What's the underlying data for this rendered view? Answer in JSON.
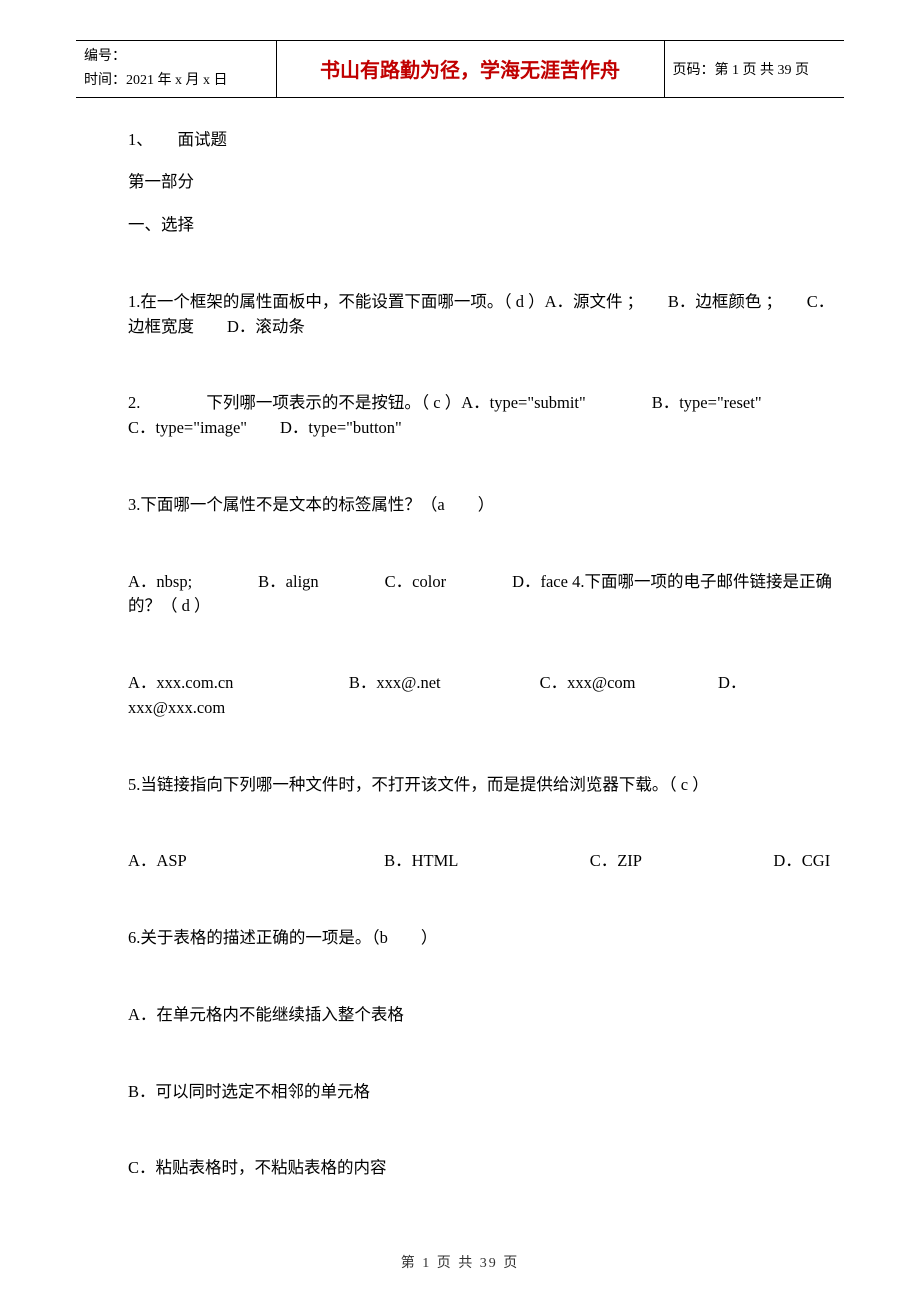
{
  "header": {
    "id_label": "编号：",
    "date_label": "时间：2021 年 x 月 x 日",
    "motto": "书山有路勤为径，学海无涯苦作舟",
    "page_label": "页码：第 1 页 共 39 页"
  },
  "content": {
    "title": "1、　　面试题",
    "part": "第一部分",
    "section": "一、选择",
    "q1": "1.在一个框架的属性面板中，不能设置下面哪一项。（  d  ）A．源文件 ；　　B．边框颜色 ；　　C．边框宽度　　D．滚动条",
    "q2": "2.　　　　下列哪一项表示的不是按钮。（  c  ）A．type=\"submit\"　　　　B．type=\"reset\"　　　　　　C．type=\"image\"　　D．type=\"button\"",
    "q3": "3.下面哪一个属性不是文本的标签属性？（a　　）",
    "q3opts": "A．nbsp;　　　　B．align　　　　C．color　　　　D．face 4.下面哪一项的电子邮件链接是正确的？（  d  ）",
    "q4opts": "A．xxx.com.cn　　　　　　　B．xxx@.net　　　　　　C．xxx@com　　　　　D．xxx@xxx.com",
    "q5": "5.当链接指向下列哪一种文件时，不打开该文件，而是提供给浏览器下载。（  c  ）",
    "q5opts": "A．ASP　　　　　　　　　　　　B．HTML　　　　　　　　C．ZIP　　　　　　　　D．CGI",
    "q6": "6.关于表格的描述正确的一项是。（b　　）",
    "q6a": "A．在单元格内不能继续插入整个表格",
    "q6b": "B．可以同时选定不相邻的单元格",
    "q6c": "C．粘贴表格时，不粘贴表格的内容"
  },
  "footer": "第 1 页 共 39 页"
}
